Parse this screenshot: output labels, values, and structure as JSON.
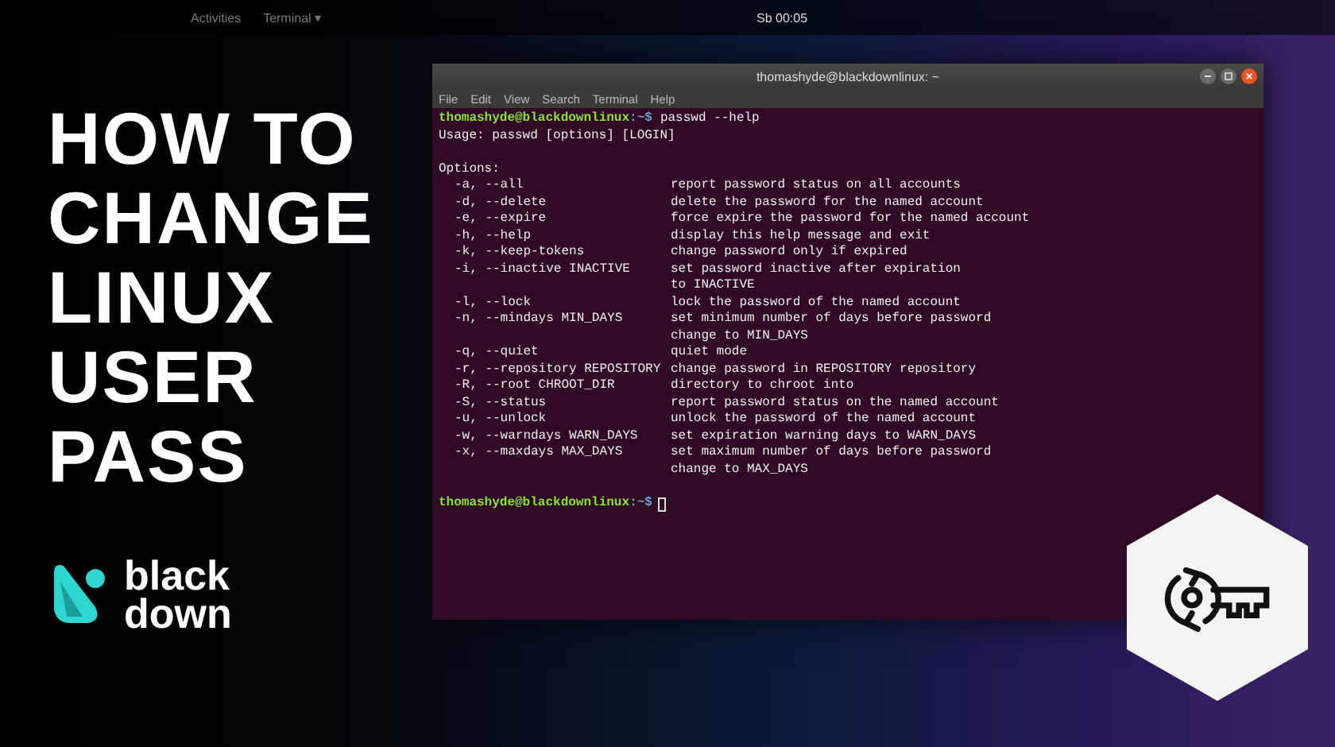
{
  "topbar": {
    "activities": "Activities",
    "app_menu": "Terminal ▾",
    "clock": "Sb 00:05"
  },
  "headline": [
    "HOW TO",
    "CHANGE",
    "LINUX",
    "USER",
    "PASS"
  ],
  "logo": {
    "line_1": "black",
    "line_2": "down"
  },
  "terminal": {
    "title": "thomashyde@blackdownlinux: ~",
    "menu": [
      "File",
      "Edit",
      "View",
      "Search",
      "Terminal",
      "Help"
    ],
    "lines": [
      {
        "kind": "prompt",
        "user": "thomashyde@blackdownlinux",
        "path": ":~$",
        "command": "passwd --help"
      },
      {
        "kind": "text",
        "text": "Usage: passwd [options] [LOGIN]"
      },
      {
        "kind": "blank"
      },
      {
        "kind": "text",
        "text": "Options:"
      },
      {
        "kind": "option",
        "flag": "-a, --all",
        "desc": "report password status on all accounts"
      },
      {
        "kind": "option",
        "flag": "-d, --delete",
        "desc": "delete the password for the named account"
      },
      {
        "kind": "option",
        "flag": "-e, --expire",
        "desc": "force expire the password for the named account"
      },
      {
        "kind": "option",
        "flag": "-h, --help",
        "desc": "display this help message and exit"
      },
      {
        "kind": "option",
        "flag": "-k, --keep-tokens",
        "desc": "change password only if expired"
      },
      {
        "kind": "option",
        "flag": "-i, --inactive INACTIVE",
        "desc": "set password inactive after expiration"
      },
      {
        "kind": "cont",
        "desc": "to INACTIVE"
      },
      {
        "kind": "option",
        "flag": "-l, --lock",
        "desc": "lock the password of the named account"
      },
      {
        "kind": "option",
        "flag": "-n, --mindays MIN_DAYS",
        "desc": "set minimum number of days before password"
      },
      {
        "kind": "cont",
        "desc": "change to MIN_DAYS"
      },
      {
        "kind": "option",
        "flag": "-q, --quiet",
        "desc": "quiet mode"
      },
      {
        "kind": "option",
        "flag": "-r, --repository REPOSITORY",
        "desc": "change password in REPOSITORY repository"
      },
      {
        "kind": "option",
        "flag": "-R, --root CHROOT_DIR",
        "desc": "directory to chroot into"
      },
      {
        "kind": "option",
        "flag": "-S, --status",
        "desc": "report password status on the named account"
      },
      {
        "kind": "option",
        "flag": "-u, --unlock",
        "desc": "unlock the password of the named account"
      },
      {
        "kind": "option",
        "flag": "-w, --warndays WARN_DAYS",
        "desc": "set expiration warning days to WARN_DAYS"
      },
      {
        "kind": "option",
        "flag": "-x, --maxdays MAX_DAYS",
        "desc": "set maximum number of days before password"
      },
      {
        "kind": "cont",
        "desc": "change to MAX_DAYS"
      },
      {
        "kind": "blank"
      },
      {
        "kind": "prompt",
        "user": "thomashyde@blackdownlinux",
        "path": ":~$",
        "cursor": true
      }
    ]
  }
}
